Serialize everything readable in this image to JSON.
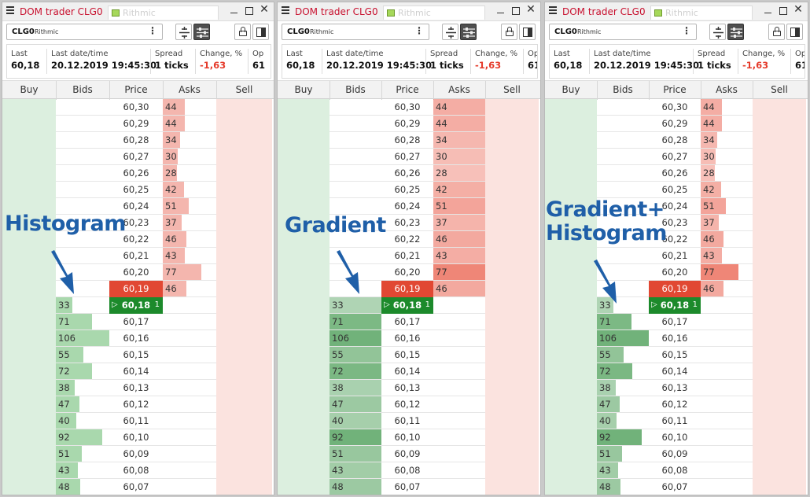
{
  "panels": [
    {
      "id": "histogram",
      "title": "DOM trader CLG0",
      "tab2": "Rithmic",
      "symbol": "CLG0",
      "connection": "Rithmic",
      "style": "histogram",
      "annotation": [
        "Histogram"
      ]
    },
    {
      "id": "gradient",
      "title": "DOM trader CLG0",
      "tab2": "Rithmic",
      "symbol": "CLG0",
      "connection": "Rithmic",
      "style": "gradient",
      "annotation": [
        "Gradient"
      ]
    },
    {
      "id": "gradient-histogram",
      "title": "DOM trader CLG0",
      "tab2": "Rithmic",
      "symbol": "CLG0",
      "connection": "Rithmic",
      "style": "both",
      "annotation": [
        "Gradient+",
        "Histogram"
      ]
    }
  ],
  "info": {
    "last_label": "Last",
    "last_value": "60,18",
    "datetime_label": "Last date/time",
    "datetime_value": "20.12.2019 19:45:30",
    "spread_label": "Spread",
    "spread_value": "1 ticks",
    "change_label": "Change, %",
    "change_value": "-1,63",
    "open_label": "Op",
    "open_value": "61"
  },
  "columns": {
    "buy": "Buy",
    "bids": "Bids",
    "price": "Price",
    "asks": "Asks",
    "sell": "Sell"
  },
  "ladder": {
    "prices": [
      "60,30",
      "60,29",
      "60,28",
      "60,27",
      "60,26",
      "60,25",
      "60,24",
      "60,23",
      "60,22",
      "60,21",
      "60,20",
      "60,19",
      "60,18",
      "60,17",
      "60,16",
      "60,15",
      "60,14",
      "60,13",
      "60,12",
      "60,11",
      "60,10",
      "60,09",
      "60,08",
      "60,07"
    ],
    "asks": [
      "44",
      "44",
      "34",
      "30",
      "28",
      "42",
      "51",
      "37",
      "46",
      "43",
      "77",
      "46",
      "",
      "",
      "",
      "",
      "",
      "",
      "",
      "",
      "",
      "",
      "",
      ""
    ],
    "bids": [
      "",
      "",
      "",
      "",
      "",
      "",
      "",
      "",
      "",
      "",
      "",
      "",
      "33",
      "71",
      "106",
      "55",
      "72",
      "38",
      "47",
      "40",
      "92",
      "51",
      "43",
      "48"
    ],
    "best_ask_index": 11,
    "best_bid_index": 12,
    "best_bid_marker": "▷",
    "best_bid_position": "1",
    "max_volume": 106
  },
  "colors": {
    "ask_fill": "#f4b6ae",
    "bid_fill": "#a9d8ad",
    "ask_best": "#e14833",
    "bid_best": "#1c8a2b",
    "title_red": "#c8102e",
    "annotation_blue": "#1f5fa8",
    "change_red": "#e53b2b"
  }
}
